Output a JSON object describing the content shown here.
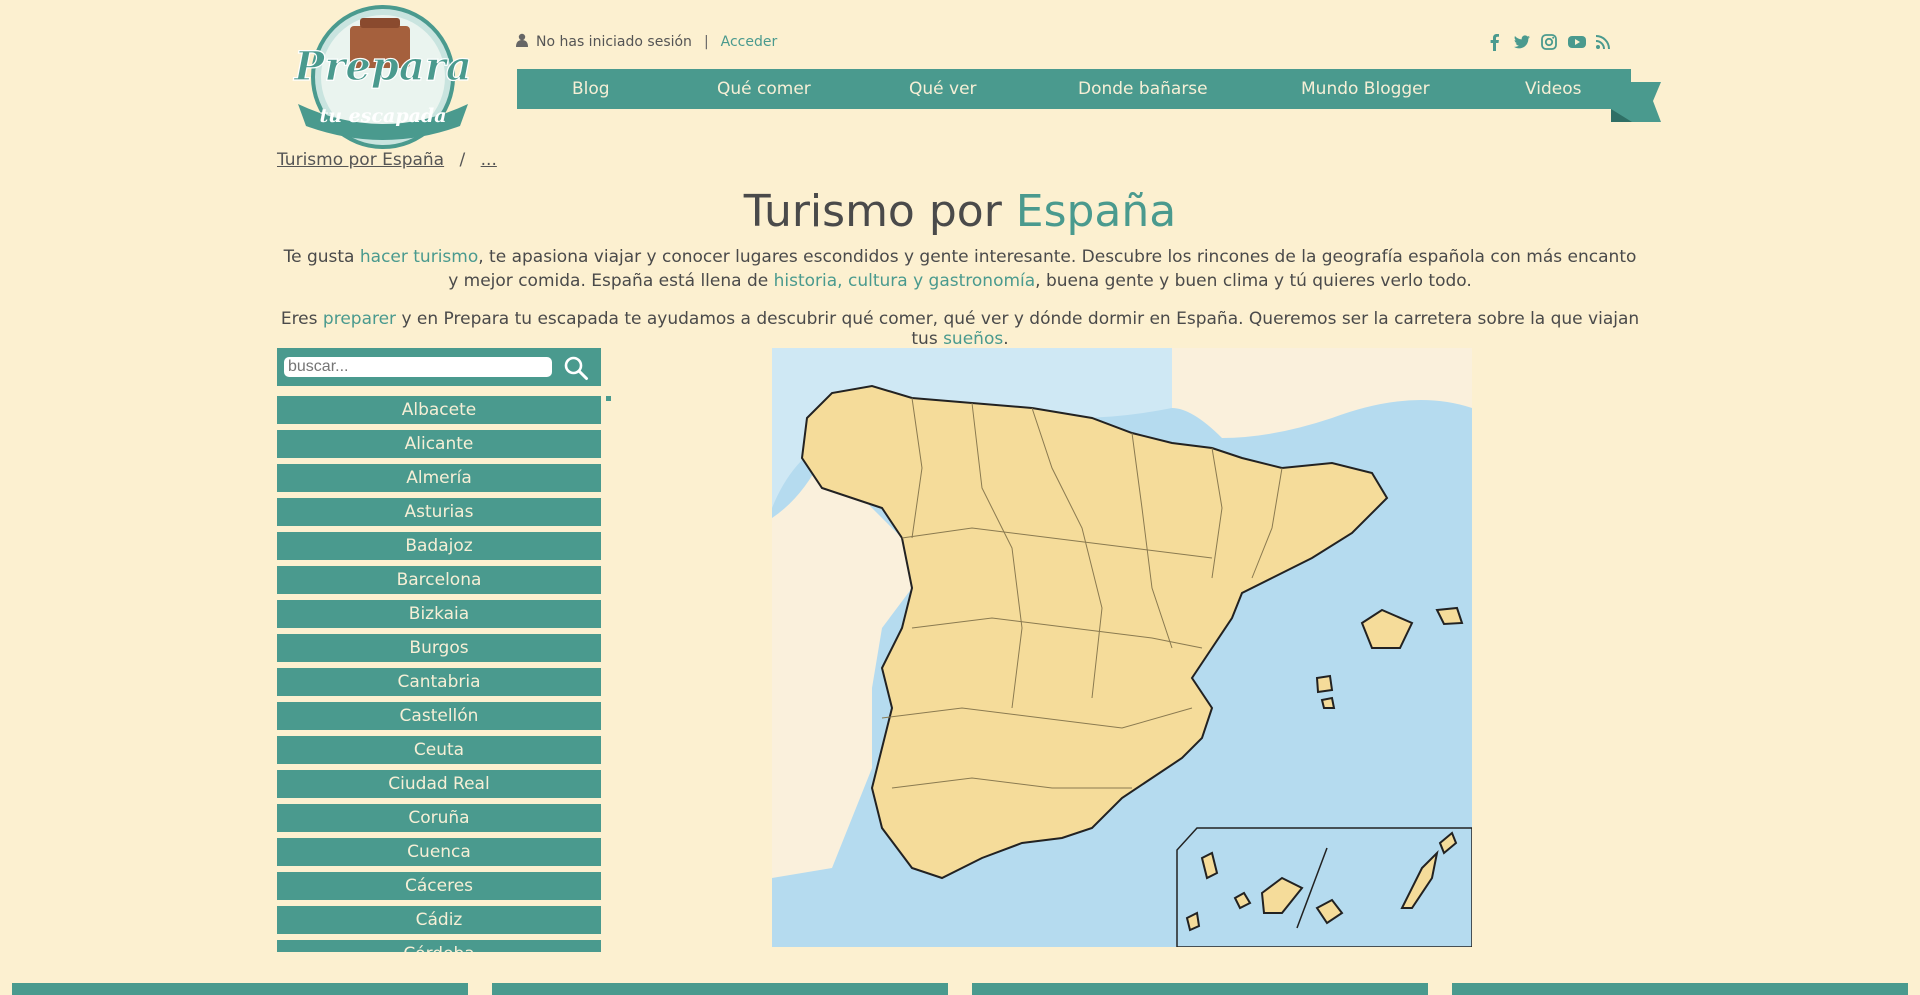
{
  "header": {
    "logo_text_top": "Prepara",
    "logo_text_bottom": "tu escapada",
    "user_status": "No has iniciado sesión",
    "separator": "|",
    "login_label": "Acceder",
    "social_icons": [
      "facebook-icon",
      "twitter-icon",
      "instagram-icon",
      "youtube-icon",
      "rss-icon"
    ]
  },
  "nav": {
    "items": [
      {
        "label": "Blog"
      },
      {
        "label": "Qué comer"
      },
      {
        "label": "Qué ver"
      },
      {
        "label": "Donde bañarse"
      },
      {
        "label": "Mundo Blogger"
      },
      {
        "label": "Videos"
      }
    ]
  },
  "breadcrumb": {
    "home": "Turismo por España",
    "separator": "/",
    "more": "..."
  },
  "title": {
    "main": "Turismo por ",
    "accent": "España"
  },
  "intro": {
    "p1_a": "Te gusta ",
    "p1_link1": "hacer turismo",
    "p1_b": ", te apasiona viajar y conocer lugares escondidos y gente interesante. Descubre los rincones de la geografía española con más encanto y mejor comida. España está llena de ",
    "p1_link2": "historia, cultura y gastronomía",
    "p1_c": ", buena gente y buen clima y tú quieres verlo todo.",
    "p2_a": "Eres ",
    "p2_link1": "preparer",
    "p2_b": " y en Prepara tu escapada te ayudamos a descubrir qué comer, qué ver y dónde dormir en España. Queremos ser la carretera sobre la que viajan tus ",
    "p2_link2": "sueños",
    "p2_c": "."
  },
  "search": {
    "placeholder": "buscar..."
  },
  "provinces": [
    "Albacete",
    "Alicante",
    "Almería",
    "Asturias",
    "Badajoz",
    "Barcelona",
    "Bizkaia",
    "Burgos",
    "Cantabria",
    "Castellón",
    "Ceuta",
    "Ciudad Real",
    "Coruña",
    "Cuenca",
    "Cáceres",
    "Cádiz",
    "Córdoba"
  ],
  "colors": {
    "background": "#fcf0d0",
    "accent": "#4a9a8e",
    "map_sea": "#b5dbef",
    "map_land": "#f5dc9a"
  }
}
